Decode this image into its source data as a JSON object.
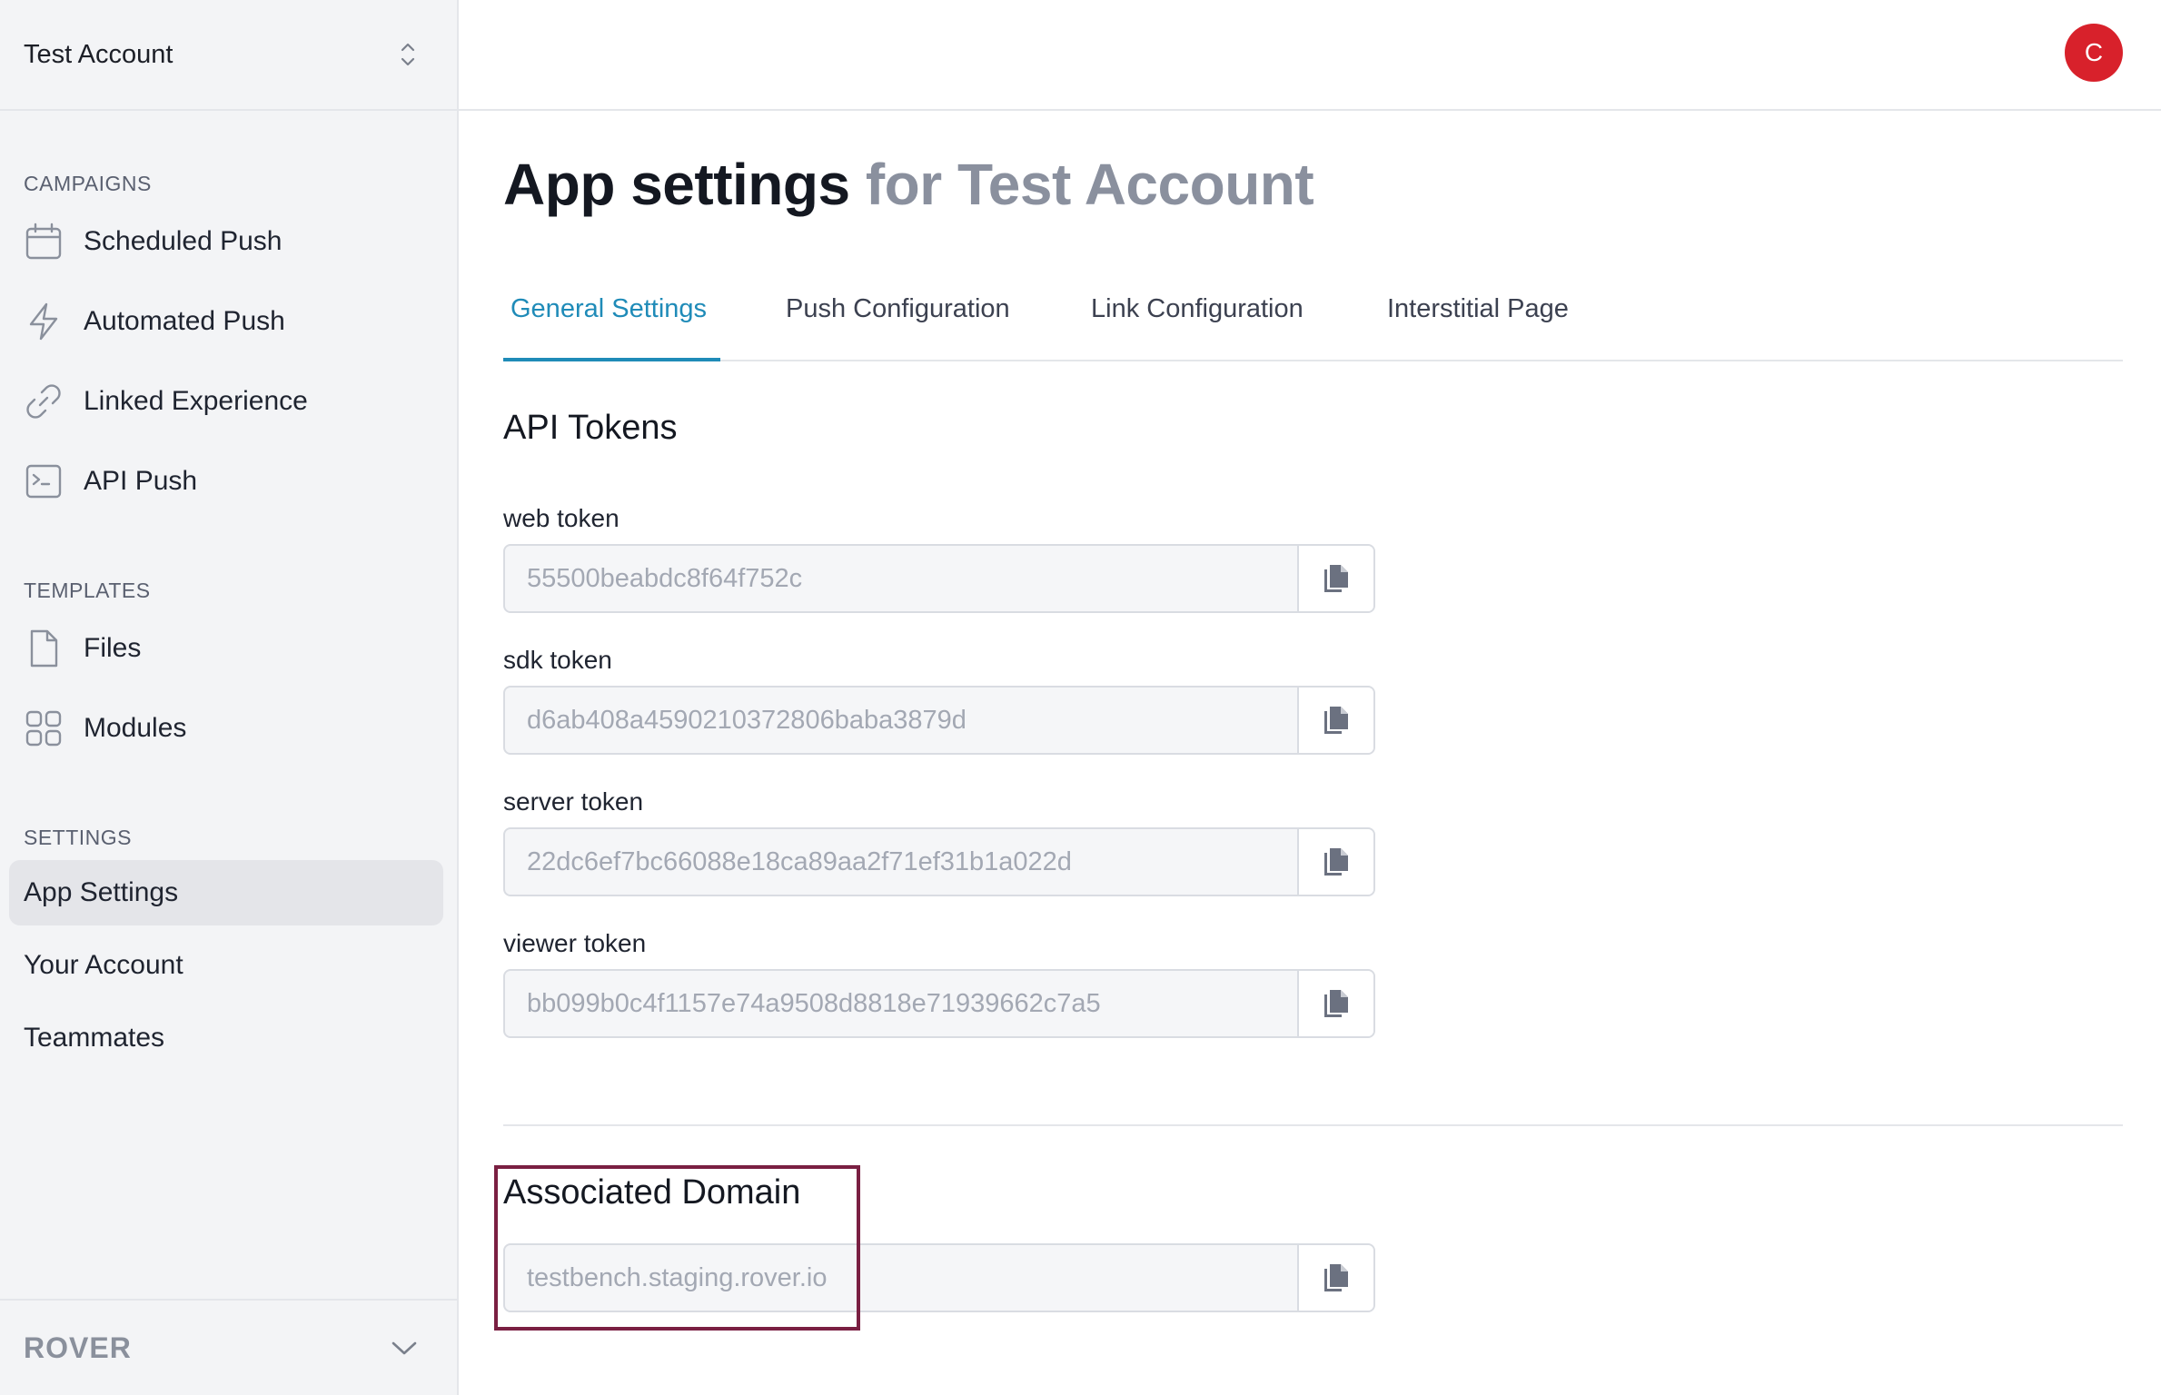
{
  "sidebar": {
    "account_name": "Test Account",
    "sections": {
      "campaigns": "CAMPAIGNS",
      "templates": "TEMPLATES",
      "settings": "SETTINGS"
    },
    "campaigns": [
      {
        "label": "Scheduled Push",
        "icon": "calendar-icon"
      },
      {
        "label": "Automated Push",
        "icon": "lightning-icon"
      },
      {
        "label": "Linked Experience",
        "icon": "link-icon"
      },
      {
        "label": "API Push",
        "icon": "terminal-icon"
      }
    ],
    "templates": [
      {
        "label": "Files",
        "icon": "file-icon"
      },
      {
        "label": "Modules",
        "icon": "grid-icon"
      }
    ],
    "settings": [
      {
        "label": "App Settings",
        "active": true
      },
      {
        "label": "Your Account"
      },
      {
        "label": "Teammates"
      }
    ],
    "brand": "ROVER"
  },
  "header": {
    "avatar_initial": "C",
    "avatar_color": "#d8212b"
  },
  "main": {
    "title": "App settings",
    "title_suffix": "for Test Account",
    "tabs": [
      {
        "label": "General Settings",
        "active": true
      },
      {
        "label": "Push Configuration"
      },
      {
        "label": "Link Configuration"
      },
      {
        "label": "Interstitial Page"
      }
    ],
    "api_tokens_heading": "API Tokens",
    "tokens": [
      {
        "label": "web token",
        "value": "55500beabdc8f64f752c"
      },
      {
        "label": "sdk token",
        "value": "d6ab408a4590210372806baba3879d"
      },
      {
        "label": "server token",
        "value": "22dc6ef7bc66088e18ca89aa2f71ef31b1a022d"
      },
      {
        "label": "viewer token",
        "value": "bb099b0c4f1157e74a9508d8818e71939662c7a5"
      }
    ],
    "associated_domain_heading": "Associated Domain",
    "associated_domain_value": "testbench.staging.rover.io"
  },
  "colors": {
    "accent": "#1f8bb8",
    "highlight_box": "#7a1f42"
  }
}
